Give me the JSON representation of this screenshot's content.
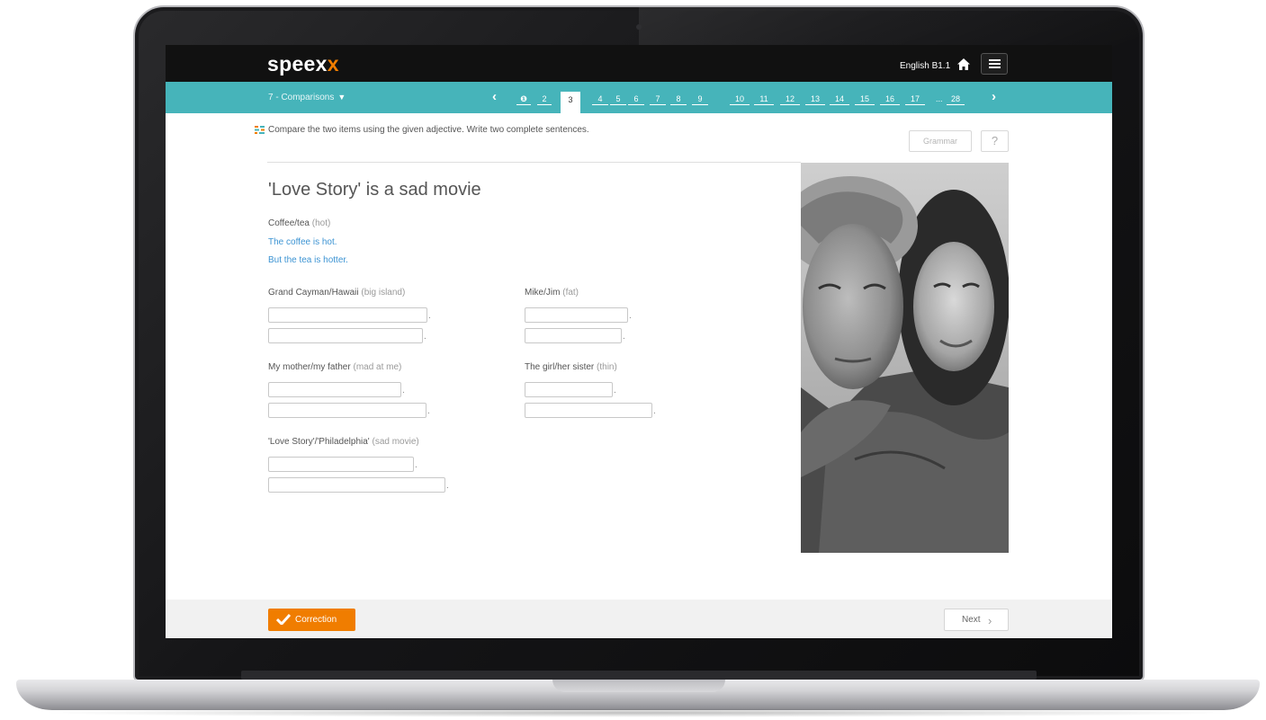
{
  "app": {
    "logo_main": "speex",
    "logo_accent": "x",
    "course": "English B1.1"
  },
  "nav": {
    "lesson": "7 - Comparisons",
    "pages": [
      "❶",
      "2",
      "3",
      "4",
      "5",
      "6",
      "7",
      "8",
      "9",
      "10",
      "11",
      "12",
      "13",
      "14",
      "15",
      "16",
      "17",
      "28"
    ],
    "current_page": "3",
    "ellipsis": "..."
  },
  "instruction": "Compare the two items using the given adjective. Write two complete sentences.",
  "buttons": {
    "grammar": "Grammar",
    "help": "?",
    "correction": "Correction",
    "next": "Next"
  },
  "exercise": {
    "title": "'Love Story' is a sad movie",
    "example": {
      "prompt": "Coffee/tea",
      "hint": "(hot)",
      "answer_1": "The coffee is hot.",
      "answer_2": "But the tea is hotter."
    },
    "items": [
      {
        "prompt": "Grand Cayman/Hawaii",
        "hint": "(big island)"
      },
      {
        "prompt": "Mike/Jim",
        "hint": "(fat)"
      },
      {
        "prompt": "My mother/my father",
        "hint": "(mad at me)"
      },
      {
        "prompt": "The girl/her sister",
        "hint": "(thin)"
      },
      {
        "prompt": "'Love Story'/'Philadelphia'",
        "hint": "(sad movie)"
      }
    ],
    "sentence_end": "."
  },
  "colors": {
    "accent": "#f07d00",
    "nav": "#46b4ba",
    "topbar": "#111111",
    "link": "#3d94d3"
  },
  "icons": {
    "home": "home-icon",
    "menu": "hamburger-icon",
    "instruction": "exercise-icon",
    "check": "check-icon"
  }
}
